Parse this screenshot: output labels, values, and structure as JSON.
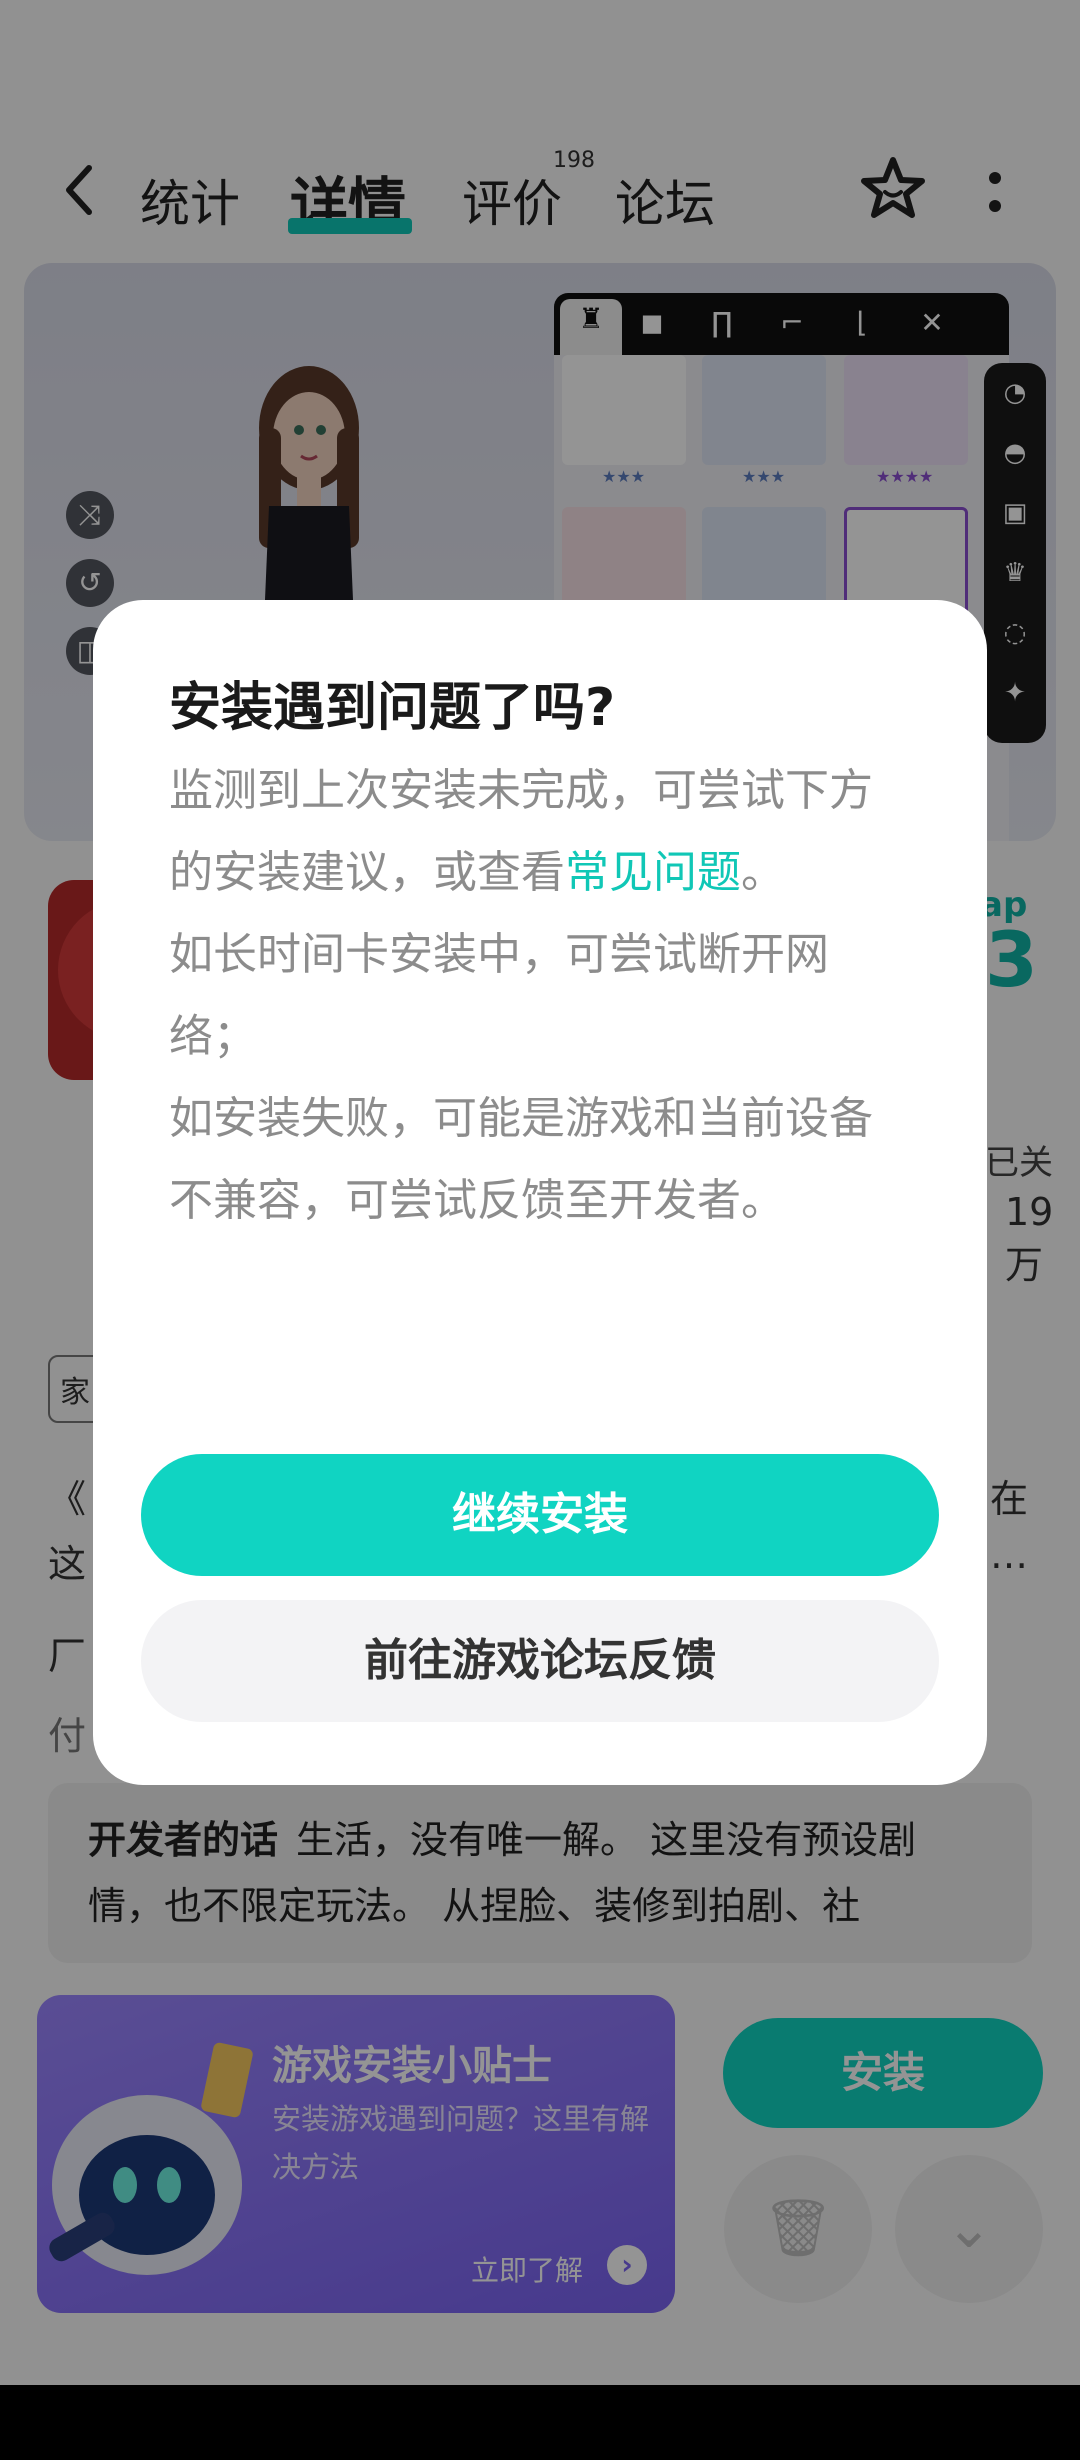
{
  "header": {
    "tabs": [
      {
        "label": "统计"
      },
      {
        "label": "详情"
      },
      {
        "label": "评价"
      },
      {
        "label": "论坛"
      }
    ],
    "review_count": "198"
  },
  "wardrobe": {
    "stars": [
      "★★★",
      "★★★",
      "★★★★"
    ]
  },
  "app": {
    "version_label": "ap",
    "version_number": "3",
    "followed_label": "已关",
    "follower_count": "19万",
    "tag_label": "家",
    "behind_line1_start": "《",
    "behind_line1_end": "在",
    "behind_line2_start": "这",
    "behind_line2_end": "…",
    "behind_line3_start": "厂",
    "behind_line4_start": "付"
  },
  "developer_note": {
    "heading": "开发者的话",
    "text": "生活，没有唯一解。 这里没有预设剧情，也不限定玩法。 从捏脸、装修到拍剧、社"
  },
  "tips_card": {
    "title": "游戏安装小贴士",
    "description": "安装游戏遇到问题？这里有解决方法",
    "more_label": "立即了解"
  },
  "actions": {
    "install_label": "安装"
  },
  "dialog": {
    "title": "安装遇到问题了吗?",
    "body_part1": "监测到上次安装未完成，可尝试下方的安装建议，或查看",
    "body_link": "常见问题",
    "body_part2": "。",
    "body_line2": "如长时间卡安装中，可尝试断开网络；",
    "body_line3": "如安装失败，可能是游戏和当前设备不兼容，可尝试反馈至开发者。",
    "primary_label": "继续安装",
    "secondary_label": "前往游戏论坛反馈"
  },
  "colors": {
    "accent": "#10d4c2",
    "tips_bg": "#8b76fb",
    "scrim": "rgba(0,0,0,0.42)"
  }
}
